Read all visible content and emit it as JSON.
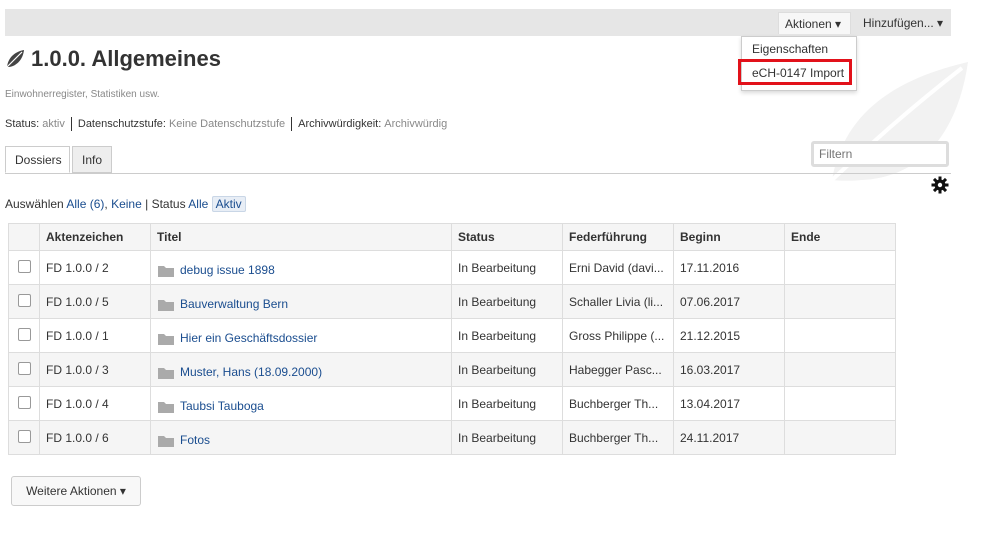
{
  "toolbar": {
    "aktionen_label": "Aktionen ▾",
    "hinzufuegen_label": "Hinzufügen... ▾",
    "dropdown_items": [
      "Eigenschaften",
      "eCH-0147 Import"
    ]
  },
  "header": {
    "title": "1.0.0. Allgemeines",
    "subtitle": "Einwohnerregister, Statistiken usw.",
    "status_label": "Status:",
    "status_value": "aktiv",
    "datenschutz_label": "Datenschutzstufe:",
    "datenschutz_value": "Keine Datenschutzstufe",
    "archiv_label": "Archivwürdigkeit:",
    "archiv_value": "Archivwürdig"
  },
  "tabs": [
    "Dossiers",
    "Info"
  ],
  "filter": {
    "placeholder": "Filtern"
  },
  "selection": {
    "label": "Auswählen",
    "all": "Alle (6)",
    "none": "Keine",
    "status_label": "| Status",
    "status_all": "Alle",
    "status_active": "Aktiv"
  },
  "table": {
    "columns": [
      "Aktenzeichen",
      "Titel",
      "Status",
      "Federführung",
      "Beginn",
      "Ende"
    ],
    "rows": [
      {
        "az": "FD 1.0.0 / 2",
        "titel": "debug issue 1898",
        "status": "In Bearbeitung",
        "ff": "Erni David (davi...",
        "beginn": "17.11.2016",
        "ende": ""
      },
      {
        "az": "FD 1.0.0 / 5",
        "titel": "Bauverwaltung Bern",
        "status": "In Bearbeitung",
        "ff": "Schaller Livia (li...",
        "beginn": "07.06.2017",
        "ende": ""
      },
      {
        "az": "FD 1.0.0 / 1",
        "titel": "Hier ein Geschäftsdossier",
        "status": "In Bearbeitung",
        "ff": "Gross Philippe (...",
        "beginn": "21.12.2015",
        "ende": ""
      },
      {
        "az": "FD 1.0.0 / 3",
        "titel": "Muster, Hans (18.09.2000)",
        "status": "In Bearbeitung",
        "ff": "Habegger Pasc...",
        "beginn": "16.03.2017",
        "ende": ""
      },
      {
        "az": "FD 1.0.0 / 4",
        "titel": "Taubsi Tauboga",
        "status": "In Bearbeitung",
        "ff": "Buchberger Th...",
        "beginn": "13.04.2017",
        "ende": ""
      },
      {
        "az": "FD 1.0.0 / 6",
        "titel": "Fotos",
        "status": "In Bearbeitung",
        "ff": "Buchberger Th...",
        "beginn": "24.11.2017",
        "ende": ""
      }
    ]
  },
  "footer": {
    "weitere_label": "Weitere Aktionen ▾"
  },
  "colors": {
    "link": "#1a4d8f",
    "highlight": "#e2111a"
  }
}
